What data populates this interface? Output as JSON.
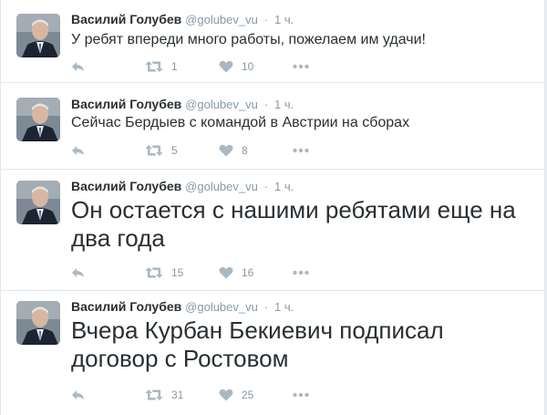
{
  "tweets": [
    {
      "name": "Василий Голубев",
      "handle": "@golubev_vu",
      "separator": "·",
      "time": "1 ч.",
      "text": "У ребят впереди много работы, пожелаем им удачи!",
      "retweets": "1",
      "likes": "10"
    },
    {
      "name": "Василий Голубев",
      "handle": "@golubev_vu",
      "separator": "·",
      "time": "1 ч.",
      "text": "Сейчас Бердыев с командой в Австрии на сборах",
      "retweets": "5",
      "likes": "8"
    },
    {
      "name": "Василий Голубев",
      "handle": "@golubev_vu",
      "separator": "·",
      "time": "1 ч.",
      "text": "Он остается с нашими ребятами еще на два года",
      "retweets": "15",
      "likes": "16"
    },
    {
      "name": "Василий Голубев",
      "handle": "@golubev_vu",
      "separator": "·",
      "time": "1 ч.",
      "text": "Вчера Курбан Бекиевич подписал договор с Ростовом",
      "retweets": "31",
      "likes": "25"
    }
  ],
  "icons": {
    "reply": "reply-icon",
    "retweet": "retweet-icon",
    "like": "heart-icon",
    "more": "more-dots-icon",
    "avatar": "avatar"
  },
  "colors": {
    "icon_gray": "#aab8c2",
    "meta_gray": "#8899a6",
    "text": "#292f33"
  }
}
